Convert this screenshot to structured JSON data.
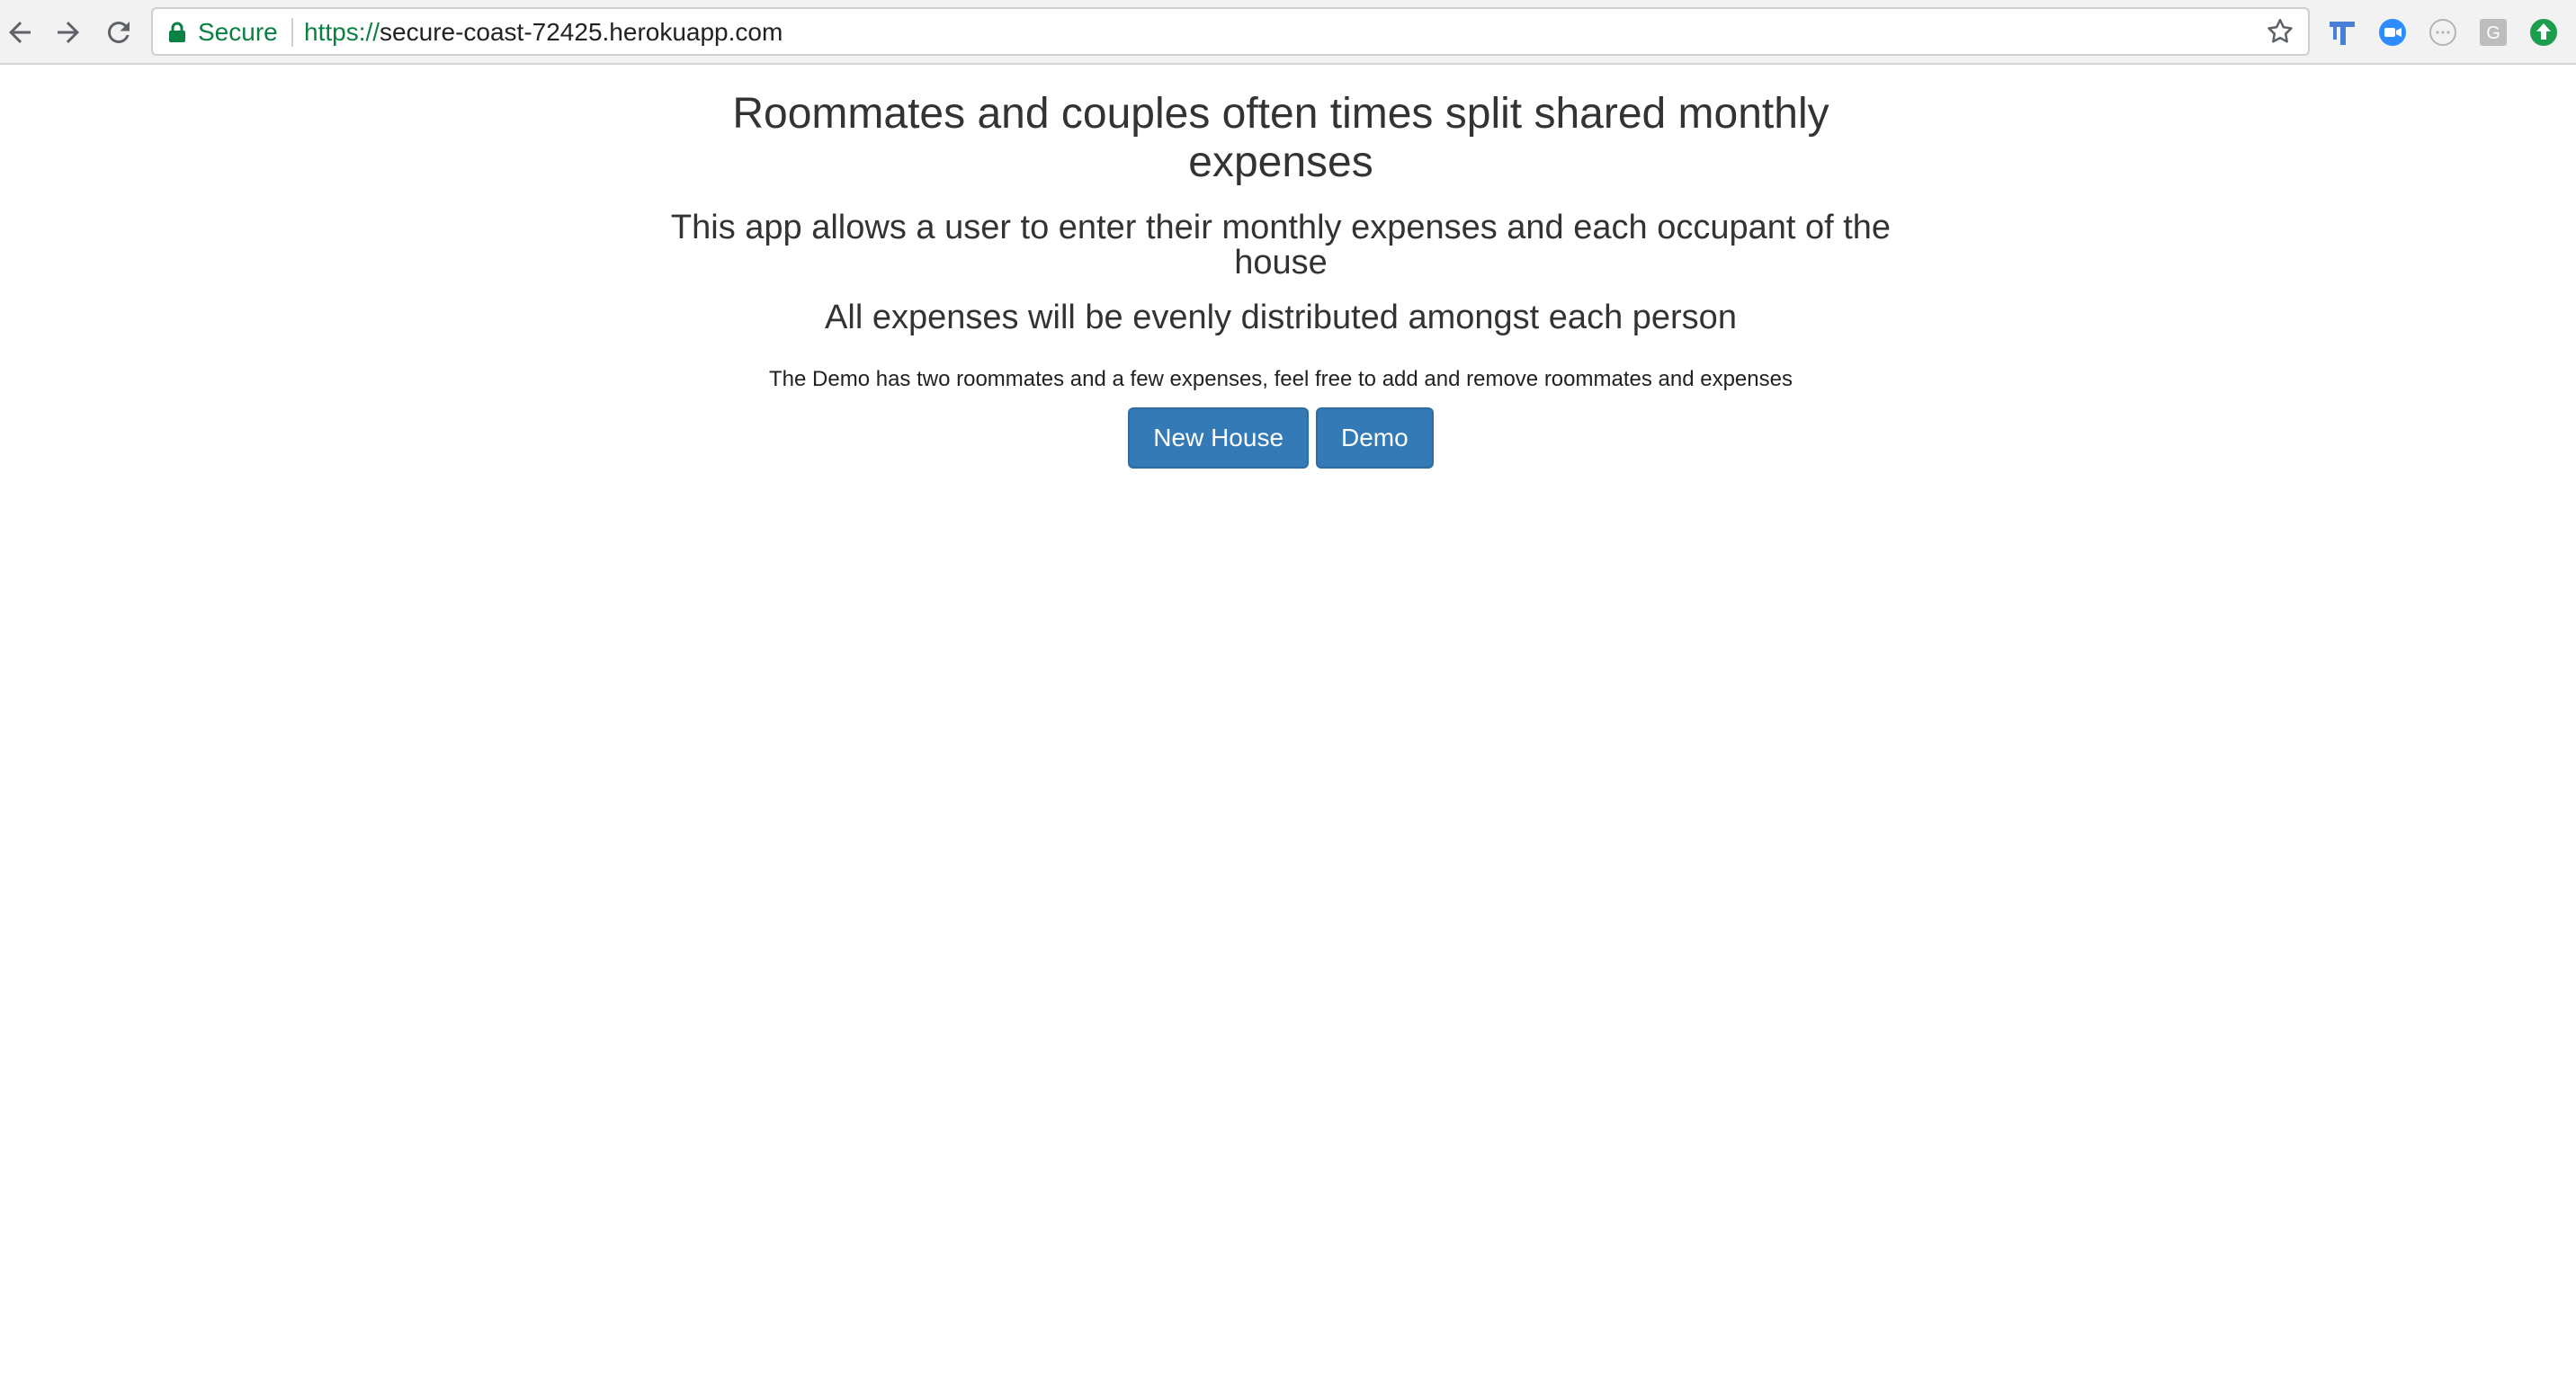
{
  "browser": {
    "secure_label": "Secure",
    "url_scheme": "https://",
    "url_host": "secure-coast-72425.herokuapp.com",
    "nav": {
      "back_icon": "arrow-left-icon",
      "forward_icon": "arrow-right-icon",
      "reload_icon": "reload-icon"
    },
    "extensions": [
      "t-extension-icon",
      "video-extension-icon",
      "dots-extension-icon",
      "g-extension-icon",
      "up-arrow-extension-icon"
    ]
  },
  "page": {
    "heading": "Roommates and couples often times split shared monthly expenses",
    "subheading_1": "This app allows a user to enter their monthly expenses and each occupant of the house",
    "subheading_2": "All expenses will be evenly distributed amongst each person",
    "demo_note": "The Demo has two roommates and a few expenses, feel free to add and remove roommates and expenses",
    "buttons": {
      "new_house": "New House",
      "demo": "Demo"
    }
  },
  "colors": {
    "primary_button": "#337ab7",
    "secure_green": "#0b8043",
    "text": "#333333"
  }
}
